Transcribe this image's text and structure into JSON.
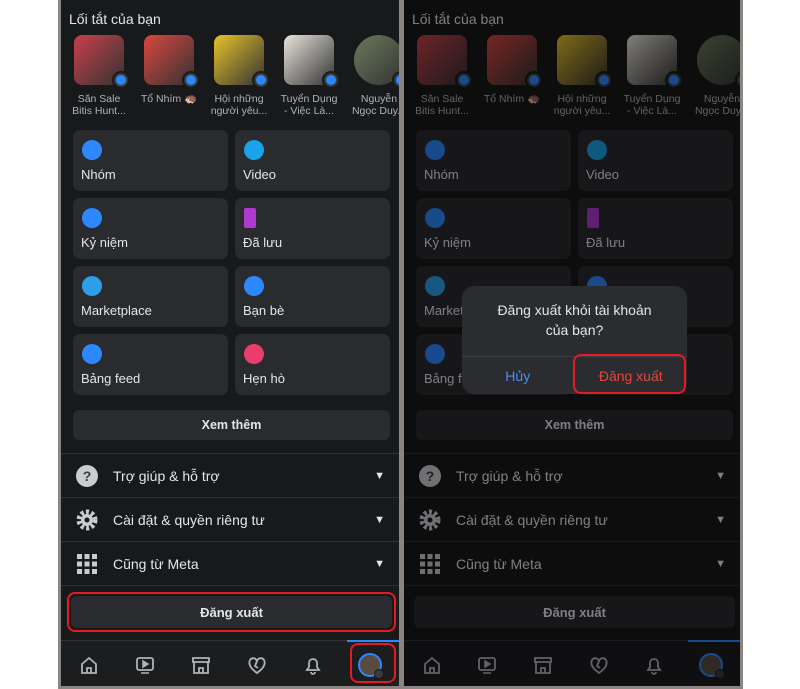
{
  "shortcuts_title": "Lối tắt của bạn",
  "shortcuts": [
    {
      "label": "Săn Sale\nBitis Hunt...",
      "color": "#c9404a",
      "round": false
    },
    {
      "label": "Tổ Nhím 🦔",
      "color": "#d9463e",
      "round": false
    },
    {
      "label": "Hội những\nngười yêu...",
      "color": "#e8c22a",
      "round": false
    },
    {
      "label": "Tuyển Dụng\n- Việc Là...",
      "color": "#e9e4dc",
      "round": false
    },
    {
      "label": "Nguyễn\nNgọc Duy...",
      "color": "#6b7a5a",
      "round": true
    }
  ],
  "menu": [
    {
      "label": "Nhóm",
      "icon": "groups-icon",
      "color": "#2d88ff"
    },
    {
      "label": "Video",
      "icon": "video-icon",
      "color": "#1aa3e8"
    },
    {
      "label": "Kỷ niệm",
      "icon": "memories-icon",
      "color": "#2d88ff"
    },
    {
      "label": "Đã lưu",
      "icon": "bookmark-icon",
      "color": "#b03ad0"
    },
    {
      "label": "Marketplace",
      "icon": "marketplace-icon",
      "color": "#2d9ee8"
    },
    {
      "label": "Bạn bè",
      "icon": "friends-icon",
      "color": "#2d88ff"
    },
    {
      "label": "Bảng feed",
      "icon": "feeds-icon",
      "color": "#2d88ff"
    },
    {
      "label": "Hẹn hò",
      "icon": "dating-heart-icon",
      "color": "#e83e6c"
    }
  ],
  "see_more": "Xem thêm",
  "sections": [
    {
      "label": "Trợ giúp & hỗ trợ",
      "icon": "help-icon"
    },
    {
      "label": "Cài đặt & quyền riêng tư",
      "icon": "gear-icon"
    },
    {
      "label": "Cũng từ Meta",
      "icon": "grid-icon"
    }
  ],
  "logout": "Đăng xuất",
  "nav": [
    "home-icon",
    "watch-icon",
    "marketplace-icon",
    "dating-icon",
    "bell-icon",
    "profile-menu-icon"
  ],
  "dialog": {
    "title": "Đăng xuất khỏi tài khoản\ncủa bạn?",
    "cancel": "Hủy",
    "confirm": "Đăng xuất"
  },
  "colors": {
    "highlight": "#e41b23",
    "accent": "#2d88ff",
    "danger": "#e5473f"
  }
}
